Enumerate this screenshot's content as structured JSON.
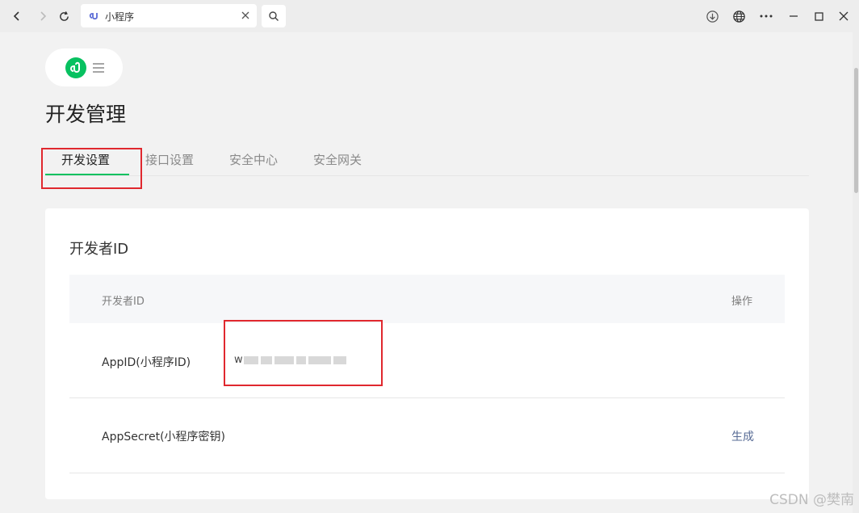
{
  "browser": {
    "tab_title": "小程序",
    "icons": {
      "back": "arrow-left-icon",
      "forward": "arrow-right-icon",
      "refresh": "refresh-icon",
      "tab": "miniprogram-icon",
      "close": "close-icon",
      "search": "search-icon",
      "download": "download-icon",
      "globe": "globe-icon",
      "more": "more-icon",
      "minimize": "minimize-icon",
      "maximize": "maximize-icon",
      "window_close": "window-close-icon"
    }
  },
  "header": {
    "title": "开发管理"
  },
  "tabs": [
    {
      "label": "开发设置",
      "active": true
    },
    {
      "label": "接口设置",
      "active": false
    },
    {
      "label": "安全中心",
      "active": false
    },
    {
      "label": "安全网关",
      "active": false
    }
  ],
  "developer_id_section": {
    "title": "开发者ID",
    "columns": [
      "开发者ID",
      "操作"
    ],
    "rows": [
      {
        "label": "AppID(小程序ID)",
        "value": "w",
        "action": ""
      },
      {
        "label": "AppSecret(小程序密钥)",
        "value": "",
        "action": "生成"
      }
    ]
  },
  "watermark": "CSDN @樊南",
  "colors": {
    "accent": "#07c160",
    "link": "#576b95",
    "highlight_box": "#e0282e",
    "page_bg": "#f2f2f2"
  }
}
